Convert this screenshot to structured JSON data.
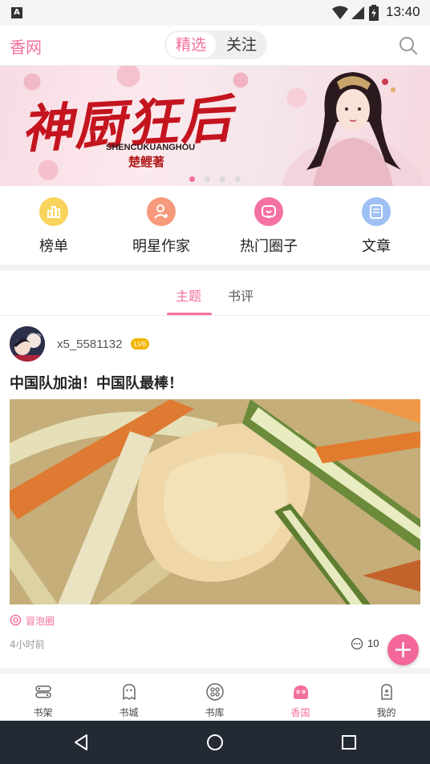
{
  "status_bar": {
    "left_icon": "A",
    "time": "13:40",
    "icons": [
      "wifi-icon",
      "signal-icon",
      "battery-icon"
    ]
  },
  "header": {
    "logo": "香网",
    "segments": [
      {
        "label": "精选",
        "active": true
      },
      {
        "label": "关注",
        "active": false
      }
    ],
    "search_icon": "search-icon"
  },
  "banner": {
    "title": "神厨狂后",
    "pinyin": "SHENCUKUANGHOU",
    "author": "楚鲤著",
    "dots": 4,
    "active_dot": 0
  },
  "quick_nav": [
    {
      "label": "榜单",
      "icon": "ranking-icon",
      "color": "#f9d45c"
    },
    {
      "label": "明星作家",
      "icon": "author-icon",
      "color": "#f79a7c"
    },
    {
      "label": "热门圈子",
      "icon": "circle-icon",
      "color": "#f571a1"
    },
    {
      "label": "文章",
      "icon": "article-icon",
      "color": "#9ec0f5"
    }
  ],
  "tabs": [
    {
      "label": "主题",
      "active": true
    },
    {
      "label": "书评",
      "active": false
    }
  ],
  "post": {
    "username": "x5_5581132",
    "level": "LV6",
    "title": "中国队加油！中国队最棒！",
    "circle": "冒泡圈",
    "time": "4小时前",
    "comments": "10"
  },
  "bottom_nav": [
    {
      "label": "书架",
      "icon": "bookshelf-icon",
      "active": false
    },
    {
      "label": "书城",
      "icon": "bookstore-icon",
      "active": false
    },
    {
      "label": "书库",
      "icon": "library-icon",
      "active": false
    },
    {
      "label": "香国",
      "icon": "community-icon",
      "active": true
    },
    {
      "label": "我的",
      "icon": "profile-icon",
      "active": false
    }
  ],
  "colors": {
    "accent": "#f36f9c",
    "system_nav": "#232a33"
  }
}
